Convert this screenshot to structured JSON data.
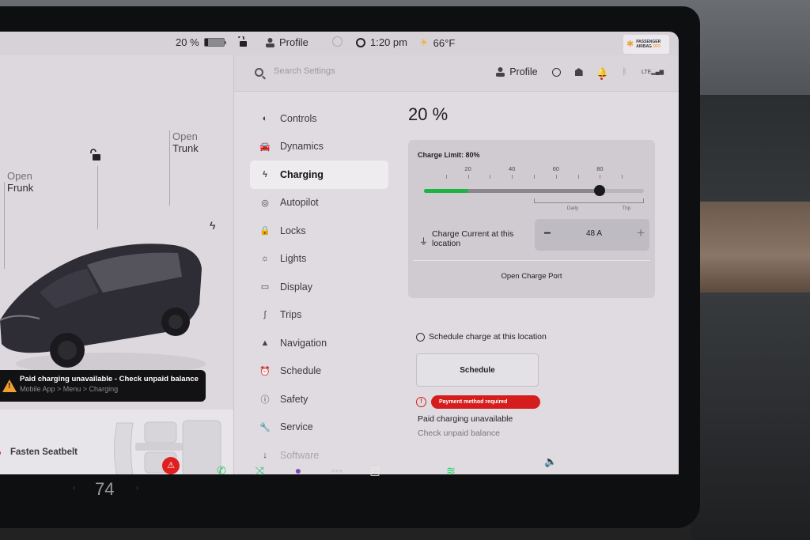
{
  "status_bar": {
    "battery_percent": "20 %",
    "battery_level": 0.2,
    "profile": "Profile",
    "time": "1:20 pm",
    "temperature": "66°F",
    "airbag": {
      "line1": "PASSENGER",
      "line2": "AIRBAG",
      "state": "OFF"
    }
  },
  "car_panel": {
    "frunk": {
      "open": "Open",
      "label": "Frunk"
    },
    "trunk": {
      "open": "Open",
      "label": "Trunk"
    },
    "alert": {
      "title": "Paid charging unavailable - Check unpaid balance",
      "subtitle": "Mobile App > Menu > Charging"
    },
    "seatbelt": "Fasten Seatbelt"
  },
  "settings": {
    "search_placeholder": "Search Settings",
    "header_profile": "Profile",
    "nav": [
      {
        "label": "Controls",
        "icon": "toggle-icon",
        "glyph": "◐"
      },
      {
        "label": "Dynamics",
        "icon": "car-icon",
        "glyph": "🚘"
      },
      {
        "label": "Charging",
        "icon": "bolt-icon",
        "glyph": "ϟ",
        "active": true
      },
      {
        "label": "Autopilot",
        "icon": "steering-wheel-icon",
        "glyph": "◎"
      },
      {
        "label": "Locks",
        "icon": "lock-icon",
        "glyph": "🔒"
      },
      {
        "label": "Lights",
        "icon": "light-icon",
        "glyph": "☼"
      },
      {
        "label": "Display",
        "icon": "display-icon",
        "glyph": "▭"
      },
      {
        "label": "Trips",
        "icon": "trips-icon",
        "glyph": "∫"
      },
      {
        "label": "Navigation",
        "icon": "navigation-icon",
        "glyph": "▲"
      },
      {
        "label": "Schedule",
        "icon": "schedule-icon",
        "glyph": "⏰"
      },
      {
        "label": "Safety",
        "icon": "safety-icon",
        "glyph": "ⓘ"
      },
      {
        "label": "Service",
        "icon": "wrench-icon",
        "glyph": "🔧"
      },
      {
        "label": "Software",
        "icon": "download-icon",
        "glyph": "↓",
        "faded": true
      }
    ]
  },
  "charging": {
    "battery_percent": "20 %",
    "charge_limit_label": "Charge Limit: 80%",
    "current_level": 20,
    "charge_limit": 80,
    "ticks": [
      10,
      20,
      30,
      40,
      50,
      60,
      70,
      80,
      90
    ],
    "tick_labels": [
      "20",
      "40",
      "60",
      "80"
    ],
    "range_labels": {
      "daily": "Daily",
      "trip": "Trip"
    },
    "charge_current_label": "Charge Current at this location",
    "charge_current_value": "48 A",
    "minus": "−",
    "plus": "+",
    "open_charge_port": "Open Charge Port",
    "schedule_heading": "Schedule charge at this location",
    "schedule_button": "Schedule",
    "payment_alert": "Payment method required",
    "paid_unavailable": "Paid charging unavailable",
    "check_balance": "Check unpaid balance"
  },
  "dock": {
    "temperature": "74",
    "apps": [
      {
        "name": "phone-icon",
        "glyph": "✆",
        "color": "#22c55e"
      },
      {
        "name": "shuffle-icon",
        "glyph": "⤨",
        "color": "#2ec27e"
      },
      {
        "name": "camera-icon",
        "glyph": "●",
        "color": "#7b4bb8"
      },
      {
        "name": "more-icon",
        "glyph": "•••",
        "color": "#cccccc"
      },
      {
        "name": "calendar-icon",
        "glyph": "▤",
        "color": "#e8e8e8"
      },
      {
        "name": "manual-icon",
        "glyph": "i",
        "color": "#dddddd"
      },
      {
        "name": "spotify-icon",
        "glyph": "≋",
        "color": "#1ed760"
      }
    ],
    "volume": "🔈"
  }
}
